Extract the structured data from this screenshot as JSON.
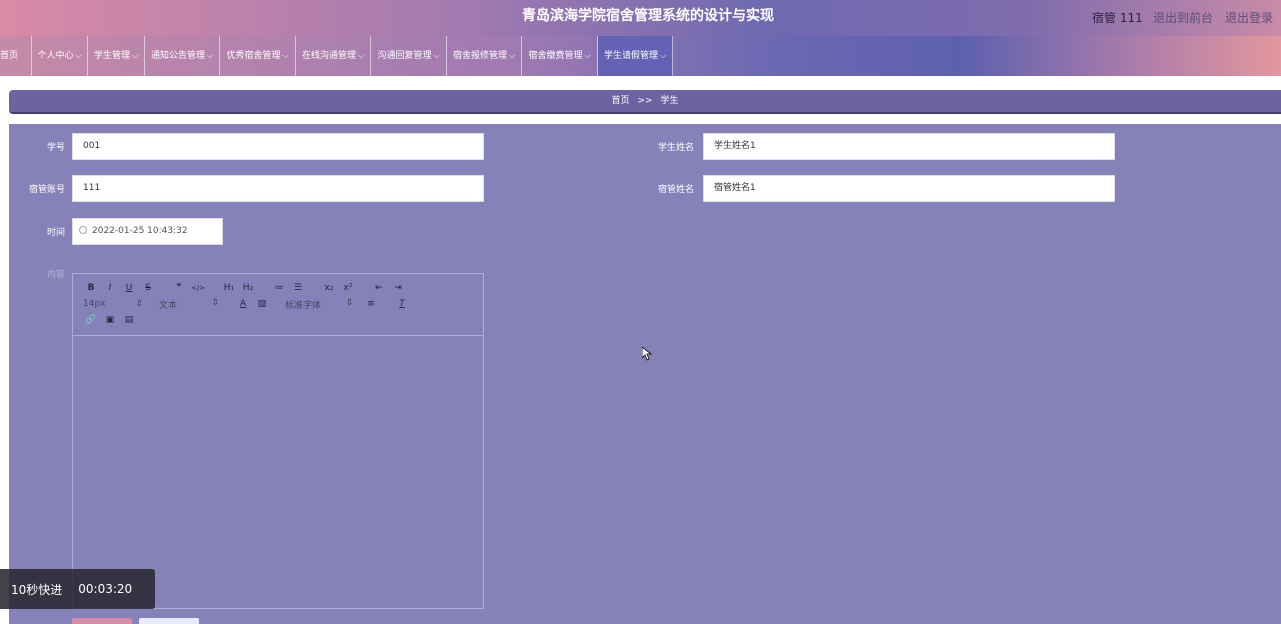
{
  "header": {
    "title": "青岛滨海学院宿舍管理系统的设计与实现",
    "user": "宿管 111",
    "back_to_front": "退出到前台",
    "logout": "退出登录"
  },
  "nav": {
    "items": [
      {
        "label": "首页"
      },
      {
        "label": "个人中心"
      },
      {
        "label": "学生管理"
      },
      {
        "label": "通知公告管理"
      },
      {
        "label": "优秀宿舍管理"
      },
      {
        "label": "在线沟通管理"
      },
      {
        "label": "沟通回复管理"
      },
      {
        "label": "宿舍报修管理"
      },
      {
        "label": "宿舍缴费管理"
      },
      {
        "label": "学生请假管理"
      }
    ]
  },
  "breadcrumb": {
    "home": "首页",
    "separator": ">>",
    "current": "学生"
  },
  "form": {
    "student_id_label": "学号",
    "student_id_value": "001",
    "student_name_label": "学生姓名",
    "student_name_value": "学生姓名1",
    "dorm_account_label": "宿管账号",
    "dorm_account_value": "111",
    "dorm_name_label": "宿管姓名",
    "dorm_name_value": "宿管姓名1",
    "time_label": "时间",
    "time_value": "2022-01-25 10:43:32",
    "content_label": "内容"
  },
  "editor": {
    "row1": [
      "B",
      "I",
      "U",
      "S",
      "❞",
      "</>",
      "H₁",
      "H₂",
      "≔",
      "☰",
      "x₂",
      "x²",
      "⇤",
      "⇥"
    ],
    "font_size": "14px",
    "text_style": "文本",
    "font_family": "标准字体",
    "row3_icons": [
      "link-icon",
      "image-icon",
      "video-icon"
    ]
  },
  "overlay": {
    "fast_forward": "10秒快进",
    "time": "00:03:20"
  },
  "colors": {
    "panel": "#8681b8",
    "breadcrumb": "#6f62a1",
    "submit": "#d58ca4"
  }
}
